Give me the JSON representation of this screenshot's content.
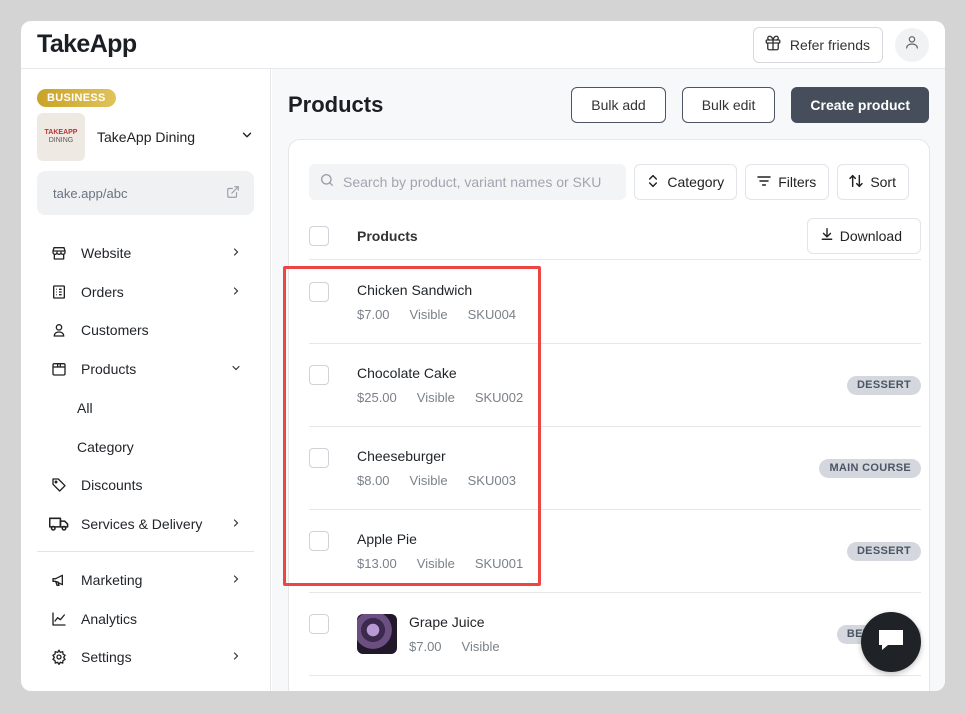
{
  "header": {
    "logo": "TakeApp",
    "refer_label": "Refer friends"
  },
  "sidebar": {
    "badge": "BUSINESS",
    "store_name": "TakeApp Dining",
    "store_logo_line1": "TAKEAPP",
    "store_logo_line2": "DINING",
    "store_link": "take.app/abc",
    "nav": [
      {
        "label": "Website"
      },
      {
        "label": "Orders"
      },
      {
        "label": "Customers"
      },
      {
        "label": "Products"
      },
      {
        "label": "Discounts"
      },
      {
        "label": "Services & Delivery"
      }
    ],
    "products_sub": [
      {
        "label": "All"
      },
      {
        "label": "Category"
      }
    ],
    "nav_bottom": [
      {
        "label": "Marketing"
      },
      {
        "label": "Analytics"
      },
      {
        "label": "Settings"
      }
    ]
  },
  "main": {
    "title": "Products",
    "bulk_add": "Bulk add",
    "bulk_edit": "Bulk edit",
    "create_product": "Create product",
    "search_placeholder": "Search by product, variant names or SKU",
    "category_label": "Category",
    "filters_label": "Filters",
    "sort_label": "Sort",
    "column_products": "Products",
    "download_label": "Download",
    "products": [
      {
        "name": "Chicken Sandwich",
        "price": "$7.00",
        "visibility": "Visible",
        "sku": "SKU004",
        "tag": ""
      },
      {
        "name": "Chocolate Cake",
        "price": "$25.00",
        "visibility": "Visible",
        "sku": "SKU002",
        "tag": "DESSERT"
      },
      {
        "name": "Cheeseburger",
        "price": "$8.00",
        "visibility": "Visible",
        "sku": "SKU003",
        "tag": "MAIN COURSE"
      },
      {
        "name": "Apple Pie",
        "price": "$13.00",
        "visibility": "Visible",
        "sku": "SKU001",
        "tag": "DESSERT"
      },
      {
        "name": "Grape Juice",
        "price": "$7.00",
        "visibility": "Visible",
        "sku": "",
        "tag": "BEVERAGE"
      }
    ]
  },
  "colors": {
    "highlight": "#ef4444",
    "primary_button": "#454e5a",
    "badge_gold": "#c9a227"
  }
}
